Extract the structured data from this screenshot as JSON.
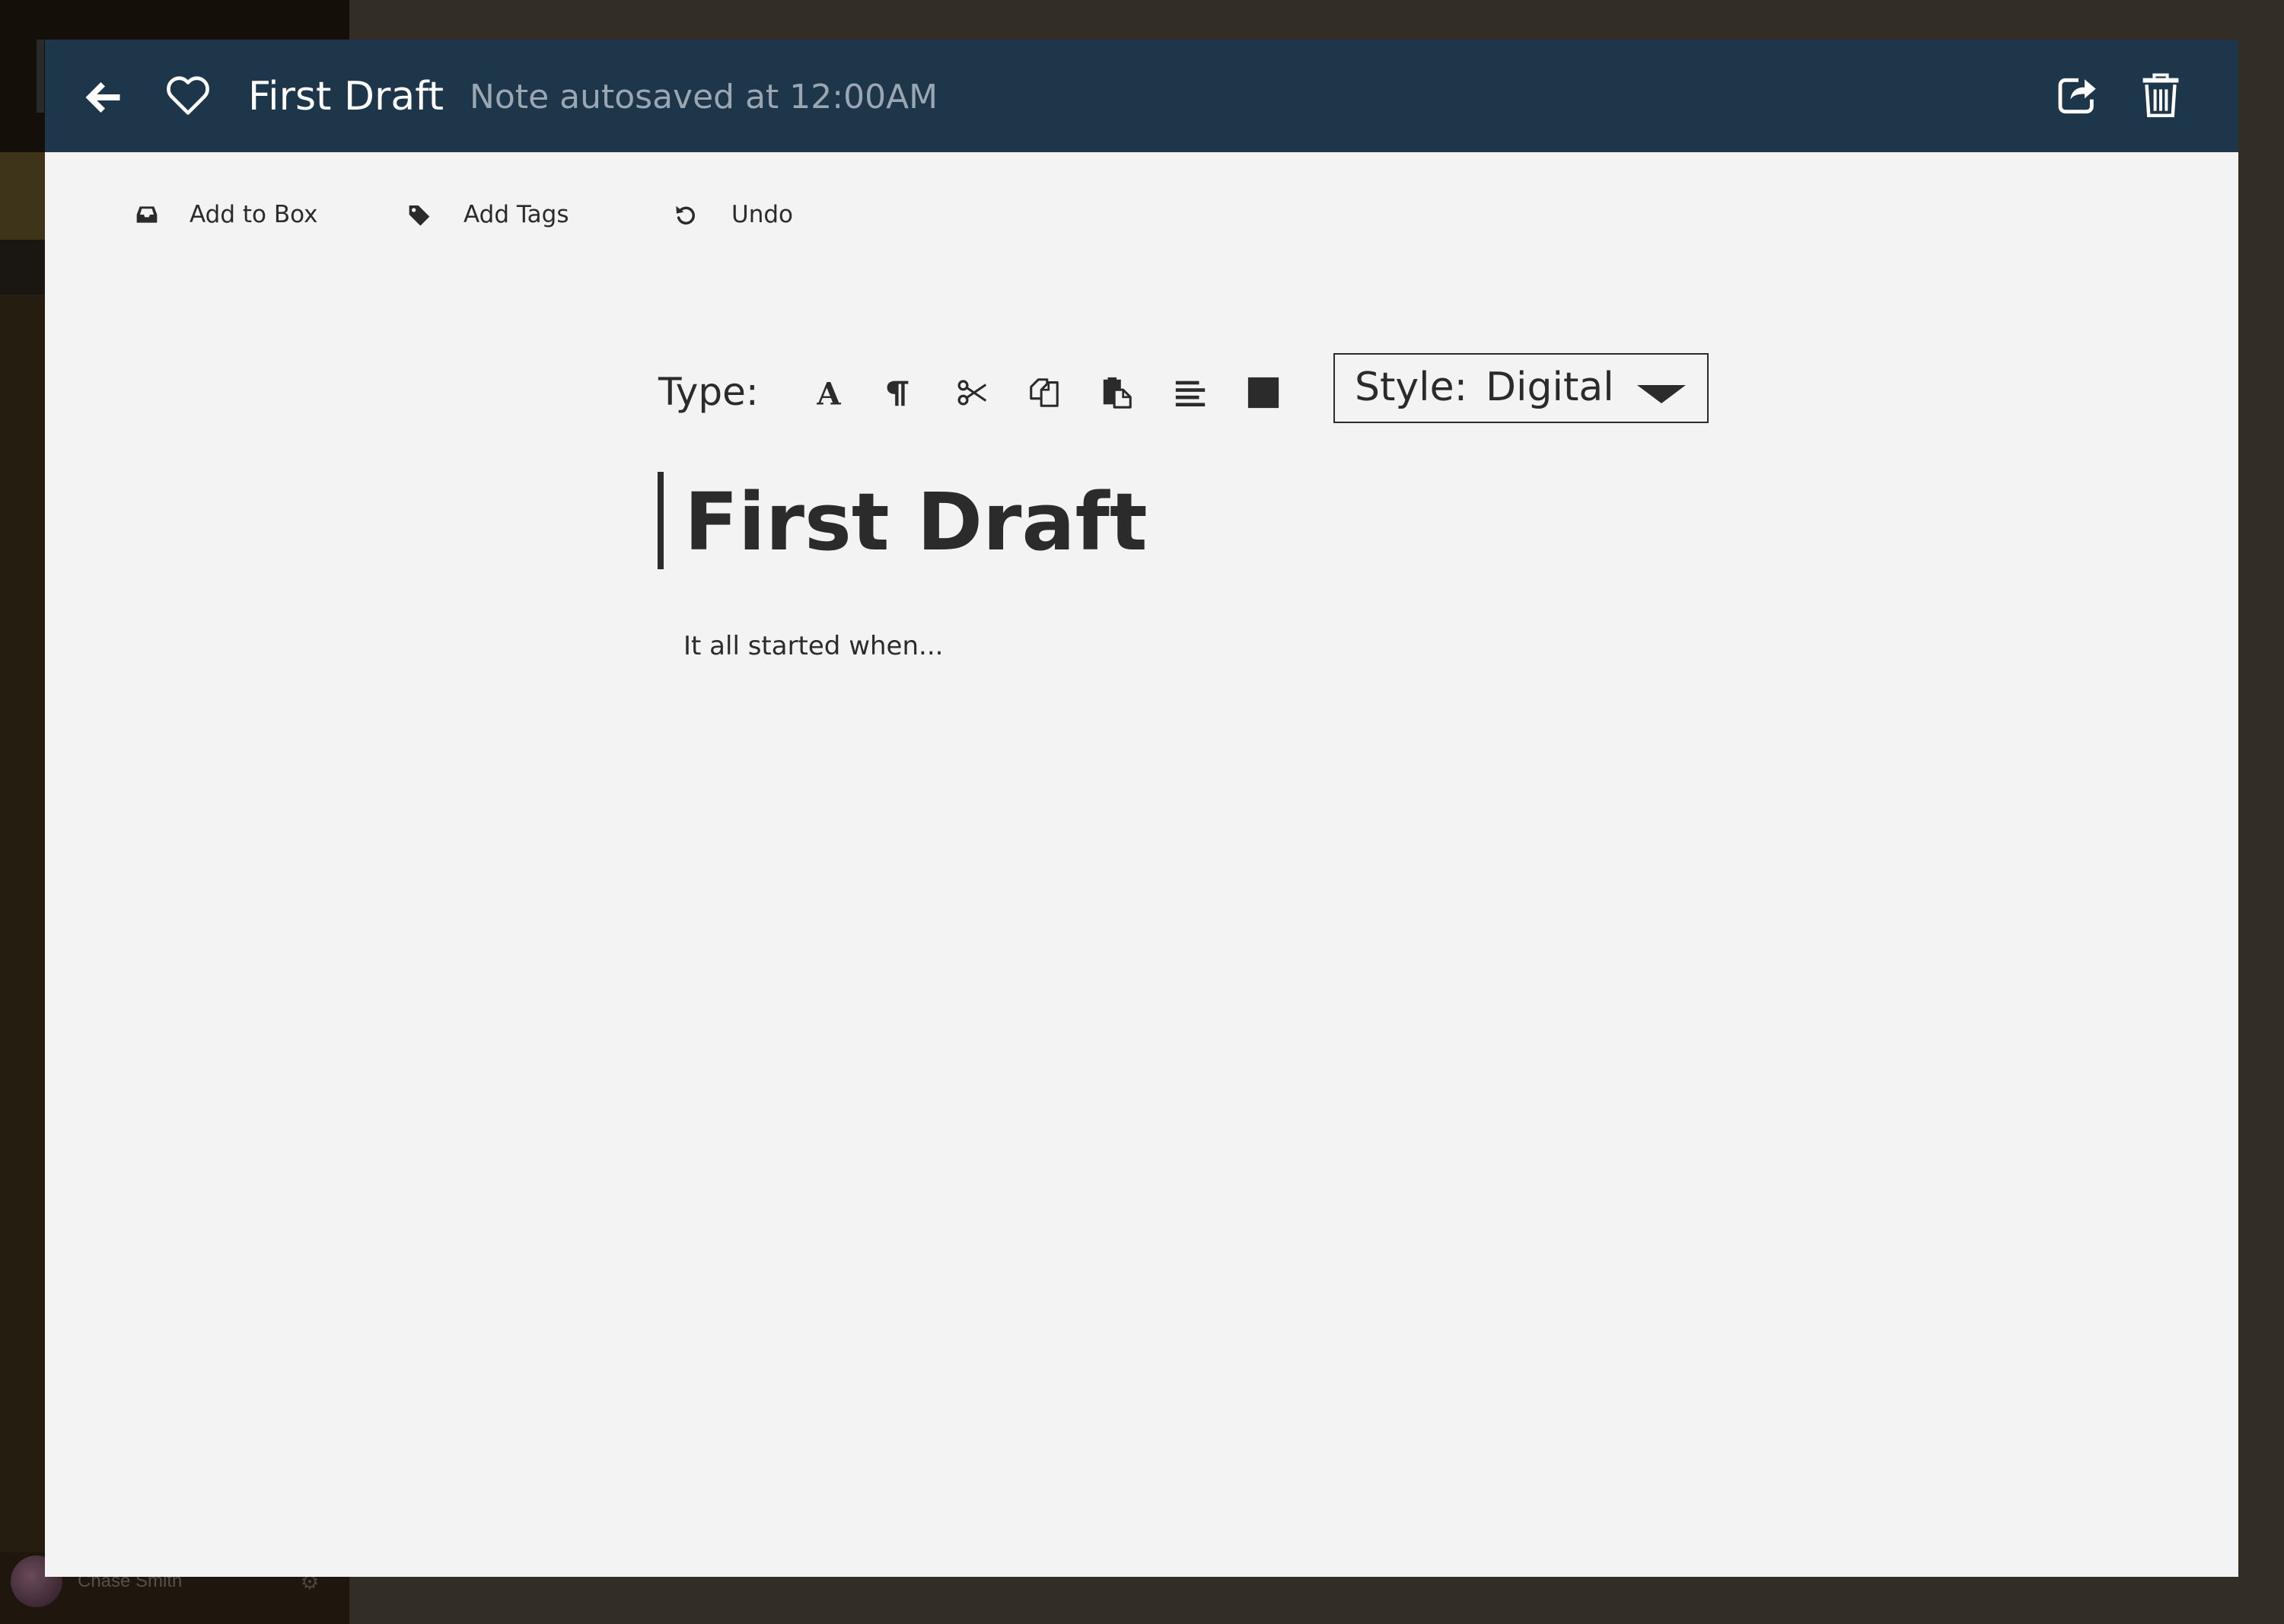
{
  "background_app": {
    "user_name": "Chase Smith",
    "settings_icon": "gear-icon"
  },
  "header": {
    "note_title": "First Draft",
    "autosave_status": "Note autosaved at 12:00AM",
    "icons": {
      "back": "arrow-left-icon",
      "favorite": "heart-outline-icon",
      "share": "share-icon",
      "delete": "trash-icon"
    },
    "background_color": "#1e364a"
  },
  "actions": {
    "add_to_box": "Add to Box",
    "add_tags": "Add Tags",
    "undo": "Undo"
  },
  "format_toolbar": {
    "type_label": "Type:",
    "tools": [
      "font-icon",
      "paragraph-icon",
      "scissors-icon",
      "copy-icon",
      "paste-icon",
      "align-left-icon",
      "color-square-icon"
    ],
    "style_label": "Style:",
    "style_value": "Digital"
  },
  "document": {
    "title": "First Draft",
    "body": "It all started when..."
  },
  "colors": {
    "editor_background": "#f3f3f3",
    "text": "#2b2b2b",
    "overlay": "#322d25"
  }
}
